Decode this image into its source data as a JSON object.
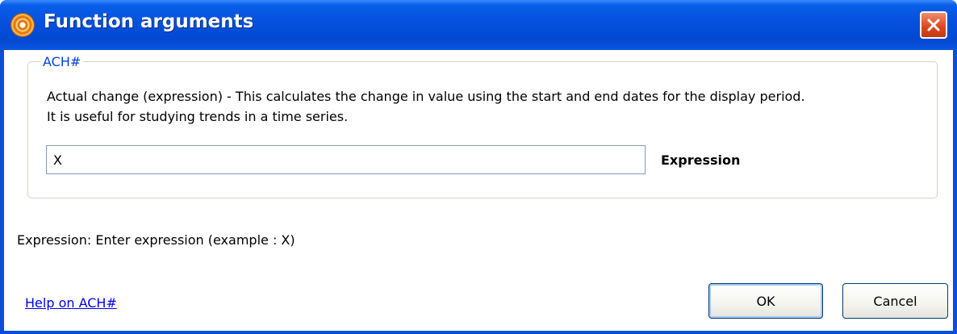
{
  "window": {
    "title": "Function arguments",
    "close_icon": "close-icon"
  },
  "group": {
    "legend": "ACH#",
    "description_line1": "Actual change (expression) - This calculates the change in value using the start and end dates for the display period.",
    "description_line2": "It is useful for studying trends in a time series."
  },
  "fields": {
    "expression": {
      "value": "X",
      "label": "Expression"
    }
  },
  "hint": "Expression: Enter expression (example : X)",
  "help_link": "Help on ACH#",
  "buttons": {
    "ok": "OK",
    "cancel": "Cancel"
  },
  "colors": {
    "titlebar": "#0550dd",
    "close_button": "#d9451d",
    "legend_text": "#0046d5",
    "link": "#0000ee"
  }
}
